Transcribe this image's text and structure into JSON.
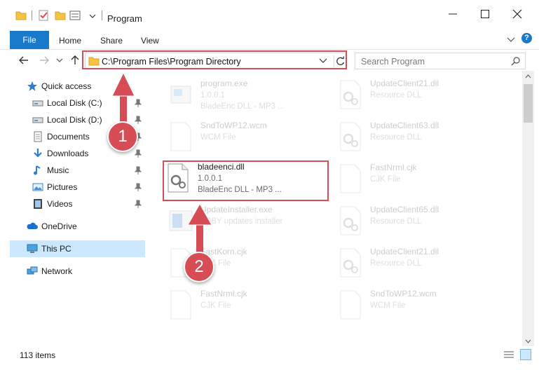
{
  "window": {
    "title": "Program",
    "controls": [
      "minimize-icon",
      "maximize-icon",
      "close-icon"
    ]
  },
  "ribbon": {
    "tabs": [
      "File",
      "Home",
      "Share",
      "View"
    ],
    "help": "?"
  },
  "address": {
    "path": "C:\\Program Files\\Program Directory"
  },
  "search": {
    "placeholder": "Search Program"
  },
  "sidebar": {
    "items": [
      {
        "label": "Quick access",
        "icon": "star-icon",
        "pinned": false
      },
      {
        "label": "Local Disk (C:)",
        "icon": "drive-icon",
        "pinned": true
      },
      {
        "label": "Local Disk (D:)",
        "icon": "drive-icon",
        "pinned": true
      },
      {
        "label": "Documents",
        "icon": "documents-icon",
        "pinned": true
      },
      {
        "label": "Downloads",
        "icon": "download-icon",
        "pinned": true
      },
      {
        "label": "Music",
        "icon": "music-icon",
        "pinned": true
      },
      {
        "label": "Pictures",
        "icon": "pictures-icon",
        "pinned": true
      },
      {
        "label": "Videos",
        "icon": "videos-icon",
        "pinned": true
      },
      {
        "label": "OneDrive",
        "icon": "cloud-icon",
        "pinned": false
      },
      {
        "label": "This PC",
        "icon": "computer-icon",
        "pinned": false,
        "selected": true
      },
      {
        "label": "Network",
        "icon": "network-icon",
        "pinned": false
      }
    ]
  },
  "files": [
    {
      "name": "program.exe",
      "line2": "1.0.0.1",
      "line3": "BladeEnc DLL - MP3 ...",
      "icon": "exe-icon",
      "faded": true
    },
    {
      "name": "UpdateClient21.dll",
      "line2": "Resource DLL",
      "line3": "",
      "icon": "dll-icon",
      "faded": true
    },
    {
      "name": "SndToWP12.wcm",
      "line2": "WCM File",
      "line3": "",
      "icon": "file-icon",
      "faded": true
    },
    {
      "name": "UpdateClient63.dll",
      "line2": "Resource DLL",
      "line3": "",
      "icon": "dll-icon",
      "faded": true
    },
    {
      "name": "bladeenci.dll",
      "line2": "1.0.0.1",
      "line3": "BladeEnc DLL - MP3 ...",
      "icon": "dll-icon",
      "faded": false
    },
    {
      "name": "FastNrml.cjk",
      "line2": "CJK File",
      "line3": "",
      "icon": "file-icon",
      "faded": true
    },
    {
      "name": "UpdateInstaller.exe",
      "line2": "ABBY updates installer",
      "line3": "",
      "icon": "installer-icon",
      "faded": true
    },
    {
      "name": "UpdateClient65.dll",
      "line2": "Resource DLL",
      "line3": "",
      "icon": "dll-icon",
      "faded": true
    },
    {
      "name": "FastKorn.cjk",
      "line2": "CJK File",
      "line3": "",
      "icon": "file-icon",
      "faded": true
    },
    {
      "name": "UpdateClient21.dll",
      "line2": "Resource DLL",
      "line3": "",
      "icon": "dll-icon",
      "faded": true
    },
    {
      "name": "FastNrml.cjk",
      "line2": "CJK File",
      "line3": "",
      "icon": "file-icon",
      "faded": true
    },
    {
      "name": "SndToWP12.wcm",
      "line2": "WCM File",
      "line3": "",
      "icon": "file-icon",
      "faded": true
    }
  ],
  "status": {
    "count": "113 items"
  },
  "annotations": {
    "step1": "1",
    "step2": "2",
    "color": "#d64d55"
  }
}
